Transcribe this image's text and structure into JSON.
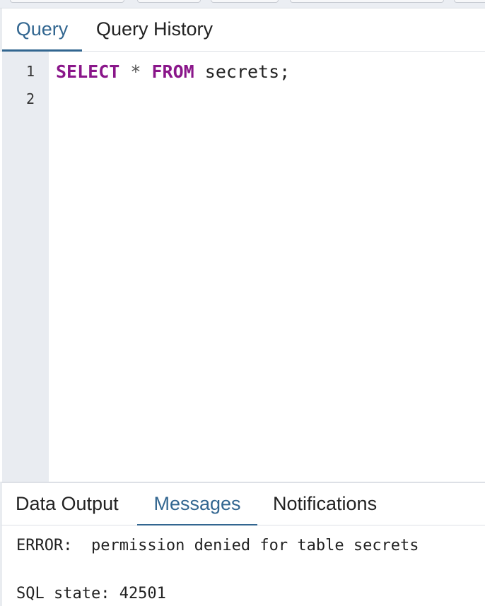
{
  "editor_tabs": [
    {
      "label": "Query",
      "active": true
    },
    {
      "label": "Query History",
      "active": false
    }
  ],
  "editor": {
    "line_numbers": [
      "1",
      "2"
    ],
    "line1": {
      "kw1": "SELECT",
      "op": "*",
      "kw2": "FROM",
      "rest": "secrets;"
    }
  },
  "panel_tabs": [
    {
      "label": "Data Output",
      "active": false
    },
    {
      "label": "Messages",
      "active": true
    },
    {
      "label": "Notifications",
      "active": false
    }
  ],
  "messages": {
    "error": "ERROR:  permission denied for table secrets",
    "sql_state": "SQL state: 42501"
  },
  "colors": {
    "accent": "#326690",
    "keyword": "#8a168a",
    "gutter": "#e9ecf1"
  }
}
